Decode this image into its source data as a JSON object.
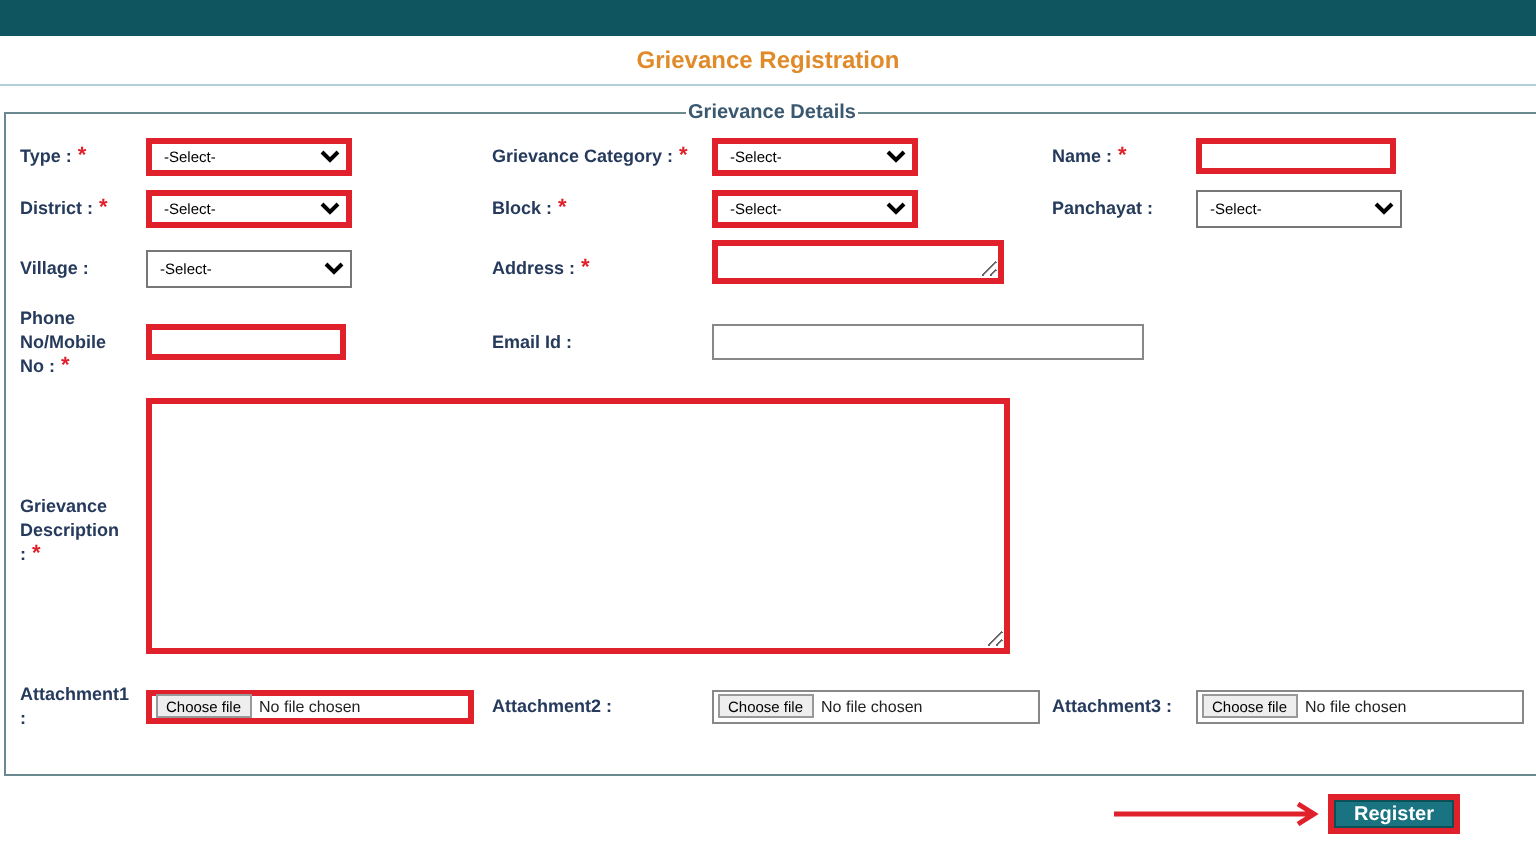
{
  "header": {
    "title": "Grievance Registration"
  },
  "fieldset": {
    "legend": "Grievance Details"
  },
  "rows": [
    {
      "kind": "normal",
      "fields": [
        {
          "label": "Type :",
          "mark": "*",
          "kind": "select",
          "value": "-Select-",
          "highlighted": true
        },
        {
          "label": "Grievance Category :",
          "mark": "*",
          "kind": "select",
          "value": "-Select-",
          "highlighted": true
        },
        {
          "label": "Name :",
          "mark": "*",
          "kind": "text",
          "highlighted": true
        }
      ]
    },
    {
      "kind": "normal",
      "fields": [
        {
          "label": "District :",
          "mark": "*",
          "kind": "select",
          "value": "-Select-",
          "highlighted": true
        },
        {
          "label": "Block :",
          "mark": "*",
          "kind": "select",
          "value": "-Select-",
          "highlighted": true
        },
        {
          "label": "Panchayat :",
          "kind": "select",
          "value": "-Select-",
          "highlighted": false
        }
      ]
    },
    {
      "kind": "normal",
      "fields": [
        {
          "label": "Village :",
          "kind": "select",
          "value": "-Select-",
          "highlighted": false
        },
        {
          "label": "Address :",
          "mark": "*",
          "kind": "area",
          "highlighted": true
        }
      ]
    },
    {
      "kind": "normal",
      "fields": [
        {
          "label": "Phone No/Mobile No :",
          "mark": "*",
          "kind": "text",
          "highlighted": true
        },
        {
          "label": "Email Id :",
          "kind": "wide",
          "highlighted": false
        }
      ]
    },
    {
      "kind": "description",
      "fields": [
        {
          "label": "Grievance Description :",
          "mark": "*",
          "kind": "description",
          "highlighted": true
        }
      ]
    },
    {
      "kind": "normal",
      "fields": [
        {
          "label": "Attachment1 :",
          "kind": "file",
          "button": "Choose file",
          "status": "No file chosen",
          "highlighted": true
        },
        {
          "label": "Attachment2 :",
          "kind": "file",
          "button": "Choose file",
          "status": "No file chosen",
          "highlighted": false
        },
        {
          "label": "Attachment3 :",
          "kind": "file",
          "button": "Choose file",
          "status": "No file chosen",
          "highlighted": false
        }
      ]
    }
  ],
  "submit": {
    "label": "Register",
    "highlighted": true
  }
}
